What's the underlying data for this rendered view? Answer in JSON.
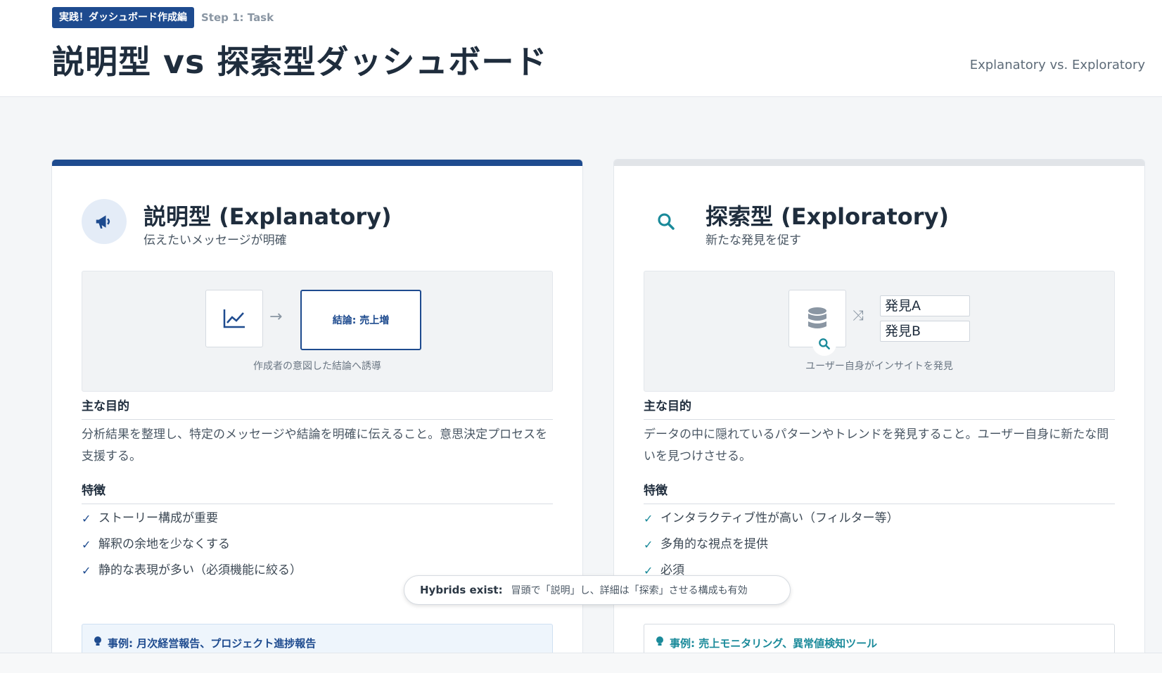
{
  "header": {
    "chapter_badge": "実践！ダッシュボード作成編",
    "step_label": "Step 1: Task",
    "title": "説明型 vs 探索型ダッシュボード",
    "subtitle": "Explanatory vs. Exploratory"
  },
  "cards": {
    "explanatory": {
      "title": "説明型 (Explanatory)",
      "subtitle": "伝えたいメッセージが明確",
      "icon": "megaphone-icon",
      "diagram": {
        "chart_icon": "line-chart-icon",
        "conclusion": "結論: 売上増",
        "caption": "作成者の意図した結論へ誘導"
      },
      "purpose_heading": "主な目的",
      "purpose_text": "分析結果を整理し、特定のメッセージや結論を明確に伝えること。意思決定プロセスを支援する。",
      "features_heading": "特徴",
      "features": [
        "ストーリー構成が重要",
        "解釈の余地を少なくする",
        "静的な表現が多い（必須機能に絞る）"
      ],
      "example": "事例: 月次経営報告、プロジェクト進捗報告"
    },
    "exploratory": {
      "title": "探索型 (Exploratory)",
      "subtitle": "新たな発見を促す",
      "icon": "search-icon",
      "diagram": {
        "db_icon": "database-icon",
        "finding_a": "発見A",
        "finding_b": "発見B",
        "caption": "ユーザー自身がインサイトを発見"
      },
      "purpose_heading": "主な目的",
      "purpose_text": "データの中に隠れているパターンやトレンドを発見すること。ユーザー自身に新たな問いを見つけさせる。",
      "features_heading": "特徴",
      "features": [
        "インタラクティブ性が高い（フィルター等）",
        "多角的な視点を提供",
        "必須"
      ],
      "example": "事例: 売上モニタリング、異常値検知ツール"
    }
  },
  "tooltip": {
    "label": "Hybrids exist:",
    "text": "冒頭で「説明」し、詳細は「探索」させる構成も有効"
  },
  "colors": {
    "primary": "#1e4b8f",
    "teal": "#1a8a9a"
  }
}
